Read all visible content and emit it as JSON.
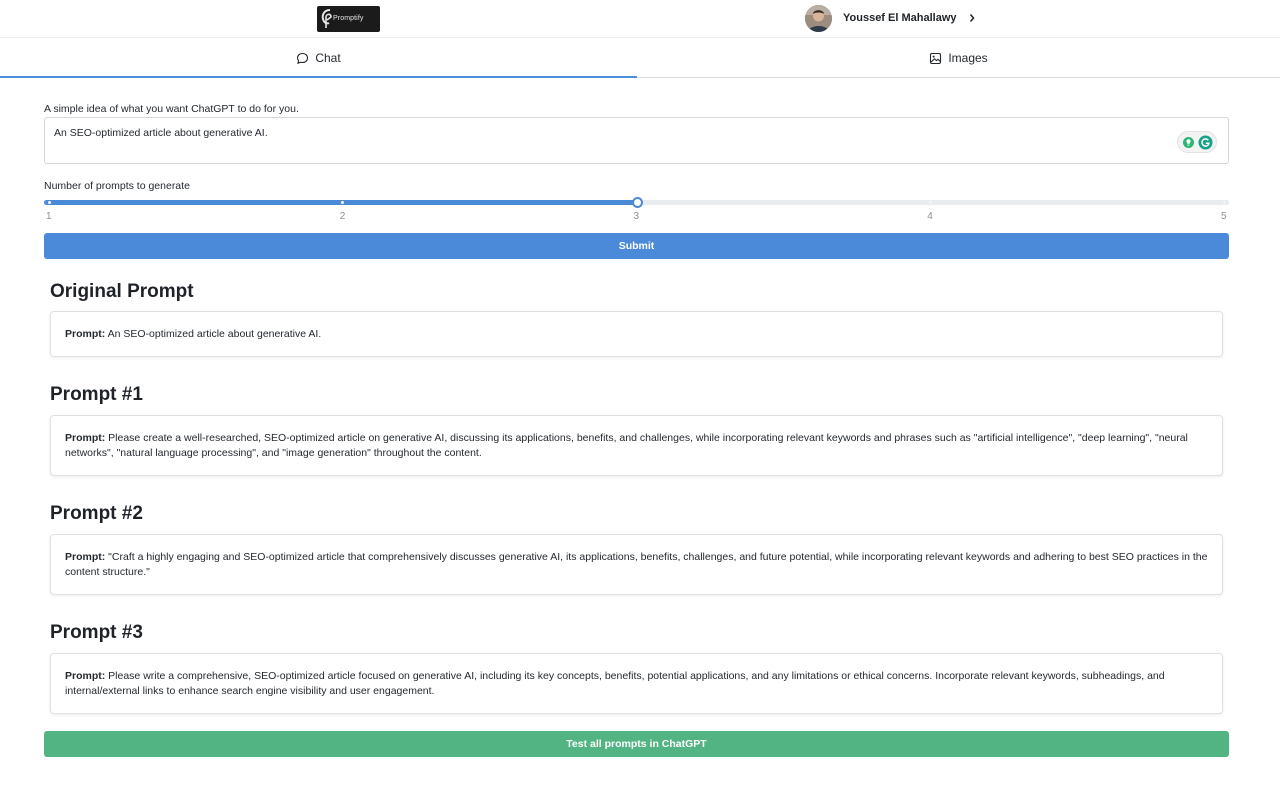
{
  "header": {
    "logo_text": "Promptify",
    "user_name": "Youssef El Mahallawy"
  },
  "tabs": [
    {
      "label": "Chat",
      "icon": "chat-bubble-icon",
      "active": true
    },
    {
      "label": "Images",
      "icon": "image-icon",
      "active": false
    }
  ],
  "form": {
    "idea_label": "A simple idea of what you want ChatGPT to do for you.",
    "idea_value": "An SEO-optimized article about generative AI.",
    "count_label": "Number of prompts to generate",
    "slider": {
      "min": 1,
      "max": 5,
      "value": 3,
      "marks": [
        "1",
        "2",
        "3",
        "4",
        "5"
      ],
      "color": "#4a8ad8"
    },
    "submit_label": "Submit"
  },
  "prompt_label": "Prompt:",
  "sections": [
    {
      "title": "Original Prompt",
      "text": "An SEO-optimized article about generative AI."
    },
    {
      "title": "Prompt #1",
      "text": "Please create a well-researched, SEO-optimized article on generative AI, discussing its applications, benefits, and challenges, while incorporating relevant keywords and phrases such as \"artificial intelligence\", \"deep learning\", \"neural networks\", \"natural language processing\", and \"image generation\" throughout the content."
    },
    {
      "title": "Prompt #2",
      "text": "\"Craft a highly engaging and SEO-optimized article that comprehensively discusses generative AI, its applications, benefits, challenges, and future potential, while incorporating relevant keywords and adhering to best SEO practices in the content structure.\""
    },
    {
      "title": "Prompt #3",
      "text": "Please write a comprehensive, SEO-optimized article focused on generative AI, including its key concepts, benefits, potential applications, and any limitations or ethical concerns. Incorporate relevant keywords, subheadings, and internal/external links to enhance search engine visibility and user engagement."
    }
  ],
  "test_all_label": "Test all prompts in ChatGPT",
  "colors": {
    "primary": "#4a8ad8",
    "success": "#52b483"
  }
}
